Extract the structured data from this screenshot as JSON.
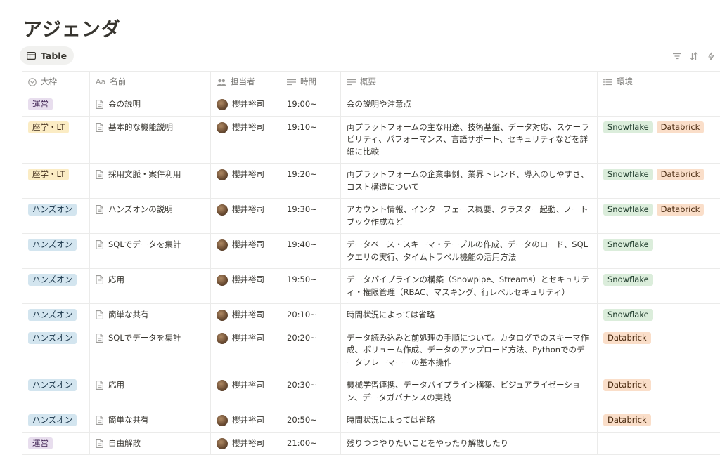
{
  "page": {
    "title": "アジェンダ"
  },
  "view": {
    "label": "Table"
  },
  "columns": {
    "category": "大枠",
    "name": "名前",
    "person": "担当者",
    "time": "時間",
    "summary": "概要",
    "env": "環境"
  },
  "rows": [
    {
      "category": "運営",
      "category_style": "ops",
      "name": "会の説明",
      "person": "櫻井裕司",
      "time": "19:00~",
      "summary": "会の説明や注意点",
      "env": []
    },
    {
      "category": "座学・LT",
      "category_style": "lecture",
      "name": "基本的な機能説明",
      "person": "櫻井裕司",
      "time": "19:10~",
      "summary": "両プラットフォームの主な用途、技術基盤、データ対応、スケーラビリティ、パフォーマンス、言語サポート、セキュリティなどを詳細に比較",
      "env": [
        "Snowflake",
        "Databrick"
      ]
    },
    {
      "category": "座学・LT",
      "category_style": "lecture",
      "name": "採用文脈・案件利用",
      "person": "櫻井裕司",
      "time": "19:20~",
      "summary": "両プラットフォームの企業事例、業界トレンド、導入のしやすさ、コスト構造について",
      "env": [
        "Snowflake",
        "Databrick"
      ]
    },
    {
      "category": "ハンズオン",
      "category_style": "hands",
      "name": "ハンズオンの説明",
      "person": "櫻井裕司",
      "time": "19:30~",
      "summary": "アカウント情報、インターフェース概要、クラスター起動、ノートブック作成など",
      "env": [
        "Snowflake",
        "Databrick"
      ]
    },
    {
      "category": "ハンズオン",
      "category_style": "hands",
      "name": "SQLでデータを集計",
      "person": "櫻井裕司",
      "time": "19:40~",
      "summary": "データベース・スキーマ・テーブルの作成、データのロード、SQLクエリの実行、タイムトラベル機能の活用方法",
      "env": [
        "Snowflake"
      ]
    },
    {
      "category": "ハンズオン",
      "category_style": "hands",
      "name": "応用",
      "person": "櫻井裕司",
      "time": "19:50~",
      "summary": "データパイプラインの構築（Snowpipe、Streams）とセキュリティ・権限管理（RBAC、マスキング、行レベルセキュリティ）",
      "env": [
        "Snowflake"
      ]
    },
    {
      "category": "ハンズオン",
      "category_style": "hands",
      "name": "簡単な共有",
      "person": "櫻井裕司",
      "time": "20:10~",
      "summary": "時間状況によっては省略",
      "env": [
        "Snowflake"
      ]
    },
    {
      "category": "ハンズオン",
      "category_style": "hands",
      "name": "SQLでデータを集計",
      "person": "櫻井裕司",
      "time": "20:20~",
      "summary": "データ読み込みと前処理の手順について。カタログでのスキーマ作成、ボリューム作成、データのアップロード方法、Pythonでのデータフレーマーーの基本操作",
      "env": [
        "Databrick"
      ]
    },
    {
      "category": "ハンズオン",
      "category_style": "hands",
      "name": "応用",
      "person": "櫻井裕司",
      "time": "20:30~",
      "summary": "機械学習連携、データパイプライン構築、ビジュアライゼーション、データガバナンスの実践",
      "env": [
        "Databrick"
      ]
    },
    {
      "category": "ハンズオン",
      "category_style": "hands",
      "name": "簡単な共有",
      "person": "櫻井裕司",
      "time": "20:50~",
      "summary": "時間状況によっては省略",
      "env": [
        "Databrick"
      ]
    },
    {
      "category": "運営",
      "category_style": "ops",
      "name": "自由解散",
      "person": "櫻井裕司",
      "time": "21:00~",
      "summary": "残りつつやりたいことをやったり解散したり",
      "env": []
    }
  ],
  "colors": {
    "ops": "#e8deee",
    "lecture": "#fbecc4",
    "hands": "#d3e5ef",
    "snowflake": "#dbeddb",
    "databrick": "#fadec9"
  }
}
